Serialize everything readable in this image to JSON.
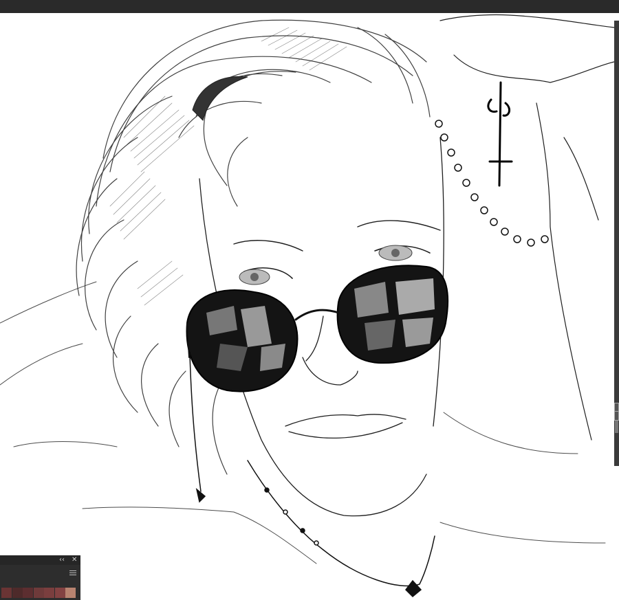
{
  "app": {
    "panel": {
      "collapse_glyph": "‹‹",
      "close_glyph": "✕"
    }
  },
  "palette": {
    "swatches": [
      "#6a3434",
      "#4e2a2a",
      "#5c2e30",
      "#6e3a3a",
      "#7a3e3e",
      "#834242",
      "#b88370"
    ]
  },
  "colors": {
    "topbar": "#2a2a2a",
    "panel": "#2d2d2d",
    "canvas": "#ffffff",
    "ink": "#1a1a1a"
  },
  "icons": [
    "collapse-icon",
    "close-icon",
    "panel-menu-icon"
  ]
}
